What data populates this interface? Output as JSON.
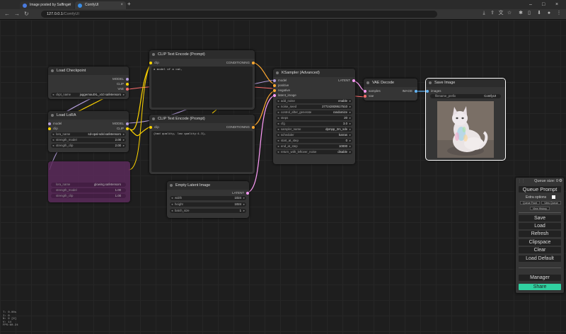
{
  "browser": {
    "tabs": [
      {
        "title": "Image posted by Saffinger",
        "close": "×"
      },
      {
        "title": "ComfyUI",
        "close": "×"
      }
    ],
    "new_tab": "+",
    "window_controls": [
      "–",
      "□",
      "×"
    ],
    "url_host": "127.0.0.1",
    "url_rest": "/ComfyUI"
  },
  "nodes": {
    "load_checkpoint": {
      "title": "Load Checkpoint",
      "outputs": [
        "MODEL",
        "CLIP",
        "VAE"
      ],
      "ckpt_label": "ckpt_name",
      "ckpt_value": "juggernautXL_v10 safetensors"
    },
    "load_lora": {
      "title": "Load LoRA",
      "inputs": [
        "model",
        "clip"
      ],
      "outputs": [
        "MODEL",
        "CLIP"
      ],
      "widgets": [
        {
          "label": "lora_name",
          "value": "sd-opal-sdxl.safetensors"
        },
        {
          "label": "strength_model",
          "value": "2.00"
        },
        {
          "label": "strength_clip",
          "value": "2.00"
        }
      ]
    },
    "bypassed_lora": {
      "widgets": [
        {
          "label": "lora_name",
          "value": "glowing.safetensors"
        },
        {
          "label": "strength_model",
          "value": "1.00"
        },
        {
          "label": "strength_clip",
          "value": "1.00"
        }
      ]
    },
    "clip_pos": {
      "title": "CLIP Text Encode (Prompt)",
      "input": "clip",
      "output": "CONDITIONING",
      "text": "a model of a cat,"
    },
    "clip_neg": {
      "title": "CLIP Text Encode (Prompt)",
      "input": "clip",
      "output": "CONDITIONING",
      "text": "(bad quality, low quality:1.3),"
    },
    "ksampler": {
      "title": "KSampler (Advanced)",
      "inputs": [
        "model",
        "positive",
        "negative",
        "latent_image"
      ],
      "output": "LATENT",
      "widgets": [
        {
          "label": "add_noise",
          "value": "enable"
        },
        {
          "label": "noise_seed",
          "value": "277242839517510"
        },
        {
          "label": "control_after_generate",
          "value": "randomize"
        },
        {
          "label": "steps",
          "value": "20"
        },
        {
          "label": "cfg",
          "value": "3.0"
        },
        {
          "label": "sampler_name",
          "value": "dpmpp_2m_sde"
        },
        {
          "label": "scheduler",
          "value": "karras"
        },
        {
          "label": "start_at_step",
          "value": "0"
        },
        {
          "label": "end_at_step",
          "value": "10000"
        },
        {
          "label": "return_with_leftover_noise",
          "value": "disable"
        }
      ]
    },
    "empty_latent": {
      "title": "Empty Latent Image",
      "output": "LATENT",
      "widgets": [
        {
          "label": "width",
          "value": "1024"
        },
        {
          "label": "height",
          "value": "1024"
        },
        {
          "label": "batch_size",
          "value": "1"
        }
      ]
    },
    "vae_decode": {
      "title": "VAE Decode",
      "inputs": [
        "samples",
        "vae"
      ],
      "output": "IMAGE"
    },
    "save_image": {
      "title": "Save Image",
      "input": "images",
      "widget_label": "filename_prefix",
      "widget_value": "ComfyUI"
    }
  },
  "menu": {
    "queue_size": "Queue size: 0",
    "queue_prompt": "Queue Prompt",
    "extra_options": "Extra options",
    "queue_front": "Queue Front",
    "view_queue": "View Queue",
    "view_history": "View History",
    "save": "Save",
    "load": "Load",
    "refresh": "Refresh",
    "clipspace": "Clipspace",
    "clear": "Clear",
    "load_default": "Load Default",
    "manager": "Manager",
    "share": "Share"
  },
  "stats": [
    "T: 0.00s",
    "I: 0",
    "N: 9 [9]",
    "V: 14",
    "FPS:60.24"
  ],
  "colors": {
    "model_wire": "#b39ddb",
    "clip_wire": "#ffd500",
    "vae_wire": "#ff6e6e",
    "conditioning_wire": "#ffa931",
    "latent_wire": "#ff9cf9",
    "image_wire": "#64b5f6",
    "share_accent": "#30d0a0"
  }
}
